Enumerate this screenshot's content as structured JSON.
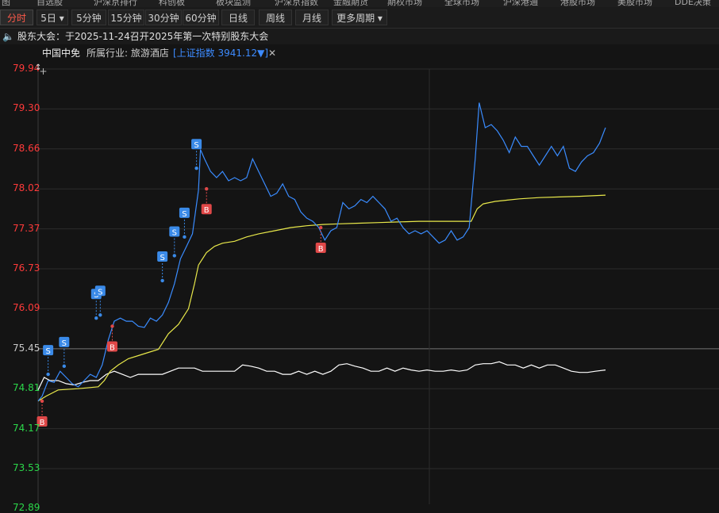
{
  "top_tabs": [
    "自选股",
    "沪深京排行",
    "科创板",
    "板块监测",
    "沪深京指数",
    "金融期货",
    "期权市场",
    "全球市场",
    "沪深港通",
    "港股市场",
    "美股市场",
    "DDE决策"
  ],
  "top_left": "图",
  "periods": [
    {
      "label": "分时",
      "active": true
    },
    {
      "label": "5日 ▾",
      "active": false
    },
    {
      "label": "5分钟",
      "active": false
    },
    {
      "label": "15分钟",
      "active": false
    },
    {
      "label": "30分钟",
      "active": false
    },
    {
      "label": "60分钟",
      "active": false
    },
    {
      "label": "日线",
      "active": false
    },
    {
      "label": "周线",
      "active": false
    },
    {
      "label": "月线",
      "active": false
    },
    {
      "label": "更多周期 ▾",
      "active": false
    }
  ],
  "notice": {
    "text": "股东大会：于2025-11-24召开2025年第一次特别股东大会"
  },
  "info": {
    "stock_name": "中国中免",
    "industry": "所属行业: 旅游酒店",
    "index": "[上证指数 3941.12▼]",
    "close": "✕"
  },
  "colors": {
    "up": "#ff3a3a",
    "down": "#2bd84a",
    "ref": "#c8c8c8",
    "price_line": "#ffffff",
    "avg_line": "#e8e84a",
    "index_line": "#3a8cff",
    "buy": "#e04848",
    "sell": "#3a8ae8"
  },
  "chart_data": {
    "type": "line",
    "ylim": [
      73.53,
      79.94
    ],
    "prev_close": 75.45,
    "y_ticks": [
      "79.94",
      "79.30",
      "78.66",
      "78.02",
      "77.37",
      "76.73",
      "76.09",
      "75.45",
      "74.81",
      "74.17",
      "73.53",
      "72.89"
    ],
    "series": [
      {
        "values": [
          [
            0,
            74.62
          ],
          [
            2,
            74.7
          ],
          [
            5,
            74.95
          ],
          [
            8,
            74.92
          ],
          [
            11,
            75.1
          ],
          [
            14,
            75.0
          ],
          [
            17,
            74.9
          ],
          [
            20,
            74.85
          ],
          [
            23,
            74.95
          ],
          [
            26,
            75.05
          ],
          [
            29,
            75.0
          ],
          [
            32,
            75.2
          ],
          [
            35,
            75.6
          ],
          [
            38,
            75.9
          ],
          [
            41,
            75.95
          ],
          [
            44,
            75.9
          ],
          [
            47,
            75.9
          ],
          [
            50,
            75.82
          ],
          [
            53,
            75.8
          ],
          [
            56,
            75.95
          ],
          [
            59,
            75.9
          ],
          [
            62,
            76.0
          ],
          [
            65,
            76.2
          ],
          [
            68,
            76.5
          ],
          [
            71,
            76.9
          ],
          [
            74,
            77.1
          ],
          [
            77,
            77.3
          ],
          [
            80,
            78.0
          ],
          [
            81,
            78.65
          ],
          [
            83,
            78.5
          ],
          [
            86,
            78.3
          ],
          [
            89,
            78.2
          ],
          [
            92,
            78.3
          ],
          [
            95,
            78.15
          ],
          [
            98,
            78.2
          ],
          [
            101,
            78.15
          ],
          [
            104,
            78.2
          ],
          [
            107,
            78.5
          ],
          [
            110,
            78.3
          ],
          [
            113,
            78.1
          ],
          [
            116,
            77.9
          ],
          [
            119,
            77.95
          ],
          [
            122,
            78.1
          ],
          [
            125,
            77.9
          ],
          [
            128,
            77.85
          ],
          [
            131,
            77.65
          ],
          [
            134,
            77.55
          ],
          [
            137,
            77.5
          ],
          [
            140,
            77.4
          ],
          [
            143,
            77.2
          ],
          [
            146,
            77.35
          ],
          [
            149,
            77.4
          ],
          [
            152,
            77.8
          ],
          [
            155,
            77.7
          ],
          [
            158,
            77.75
          ],
          [
            161,
            77.85
          ],
          [
            164,
            77.8
          ],
          [
            167,
            77.9
          ],
          [
            170,
            77.8
          ],
          [
            173,
            77.7
          ],
          [
            176,
            77.5
          ],
          [
            179,
            77.55
          ],
          [
            182,
            77.4
          ],
          [
            185,
            77.3
          ],
          [
            188,
            77.35
          ],
          [
            191,
            77.3
          ],
          [
            194,
            77.35
          ],
          [
            197,
            77.25
          ],
          [
            200,
            77.15
          ],
          [
            203,
            77.2
          ],
          [
            206,
            77.35
          ],
          [
            209,
            77.2
          ],
          [
            212,
            77.25
          ],
          [
            215,
            77.4
          ],
          [
            218,
            78.5
          ],
          [
            220,
            79.4
          ],
          [
            223,
            79.0
          ],
          [
            226,
            79.05
          ],
          [
            229,
            78.95
          ],
          [
            232,
            78.8
          ],
          [
            235,
            78.6
          ],
          [
            238,
            78.85
          ],
          [
            241,
            78.7
          ],
          [
            244,
            78.7
          ],
          [
            247,
            78.55
          ],
          [
            250,
            78.4
          ],
          [
            253,
            78.55
          ],
          [
            256,
            78.7
          ],
          [
            259,
            78.55
          ],
          [
            262,
            78.7
          ],
          [
            265,
            78.35
          ],
          [
            268,
            78.3
          ],
          [
            271,
            78.45
          ],
          [
            274,
            78.55
          ],
          [
            277,
            78.6
          ],
          [
            280,
            78.75
          ],
          [
            283,
            79.0
          ]
        ]
      },
      {
        "values": [
          [
            0,
            74.62
          ],
          [
            4,
            74.7
          ],
          [
            10,
            74.8
          ],
          [
            20,
            74.82
          ],
          [
            30,
            74.85
          ],
          [
            33,
            74.95
          ],
          [
            36,
            75.1
          ],
          [
            40,
            75.2
          ],
          [
            45,
            75.3
          ],
          [
            50,
            75.35
          ],
          [
            55,
            75.4
          ],
          [
            60,
            75.45
          ],
          [
            65,
            75.7
          ],
          [
            70,
            75.85
          ],
          [
            75,
            76.1
          ],
          [
            78,
            76.5
          ],
          [
            80,
            76.8
          ],
          [
            84,
            77.0
          ],
          [
            88,
            77.1
          ],
          [
            92,
            77.15
          ],
          [
            98,
            77.18
          ],
          [
            104,
            77.25
          ],
          [
            110,
            77.3
          ],
          [
            118,
            77.35
          ],
          [
            126,
            77.4
          ],
          [
            134,
            77.43
          ],
          [
            142,
            77.45
          ],
          [
            150,
            77.46
          ],
          [
            160,
            77.47
          ],
          [
            170,
            77.48
          ],
          [
            180,
            77.49
          ],
          [
            190,
            77.5
          ],
          [
            200,
            77.5
          ],
          [
            210,
            77.5
          ],
          [
            216,
            77.5
          ],
          [
            219,
            77.7
          ],
          [
            222,
            77.78
          ],
          [
            228,
            77.82
          ],
          [
            234,
            77.84
          ],
          [
            240,
            77.86
          ],
          [
            250,
            77.88
          ],
          [
            260,
            77.89
          ],
          [
            270,
            77.9
          ],
          [
            283,
            77.92
          ]
        ]
      },
      {
        "values": [
          [
            0,
            74.8
          ],
          [
            3,
            75.0
          ],
          [
            6,
            74.95
          ],
          [
            10,
            74.95
          ],
          [
            14,
            74.9
          ],
          [
            18,
            74.88
          ],
          [
            22,
            74.92
          ],
          [
            26,
            74.95
          ],
          [
            30,
            74.95
          ],
          [
            34,
            75.05
          ],
          [
            38,
            75.1
          ],
          [
            42,
            75.05
          ],
          [
            46,
            75.0
          ],
          [
            50,
            75.05
          ],
          [
            54,
            75.05
          ],
          [
            58,
            75.05
          ],
          [
            62,
            75.05
          ],
          [
            66,
            75.1
          ],
          [
            70,
            75.15
          ],
          [
            74,
            75.15
          ],
          [
            78,
            75.15
          ],
          [
            82,
            75.1
          ],
          [
            86,
            75.1
          ],
          [
            90,
            75.1
          ],
          [
            94,
            75.1
          ],
          [
            98,
            75.1
          ],
          [
            102,
            75.2
          ],
          [
            106,
            75.18
          ],
          [
            110,
            75.15
          ],
          [
            114,
            75.1
          ],
          [
            118,
            75.1
          ],
          [
            122,
            75.05
          ],
          [
            126,
            75.05
          ],
          [
            130,
            75.1
          ],
          [
            134,
            75.05
          ],
          [
            138,
            75.1
          ],
          [
            142,
            75.05
          ],
          [
            146,
            75.1
          ],
          [
            150,
            75.2
          ],
          [
            154,
            75.22
          ],
          [
            158,
            75.18
          ],
          [
            162,
            75.15
          ],
          [
            166,
            75.1
          ],
          [
            170,
            75.1
          ],
          [
            174,
            75.15
          ],
          [
            178,
            75.1
          ],
          [
            182,
            75.15
          ],
          [
            186,
            75.12
          ],
          [
            190,
            75.1
          ],
          [
            194,
            75.12
          ],
          [
            198,
            75.1
          ],
          [
            202,
            75.1
          ],
          [
            206,
            75.12
          ],
          [
            210,
            75.1
          ],
          [
            214,
            75.12
          ],
          [
            218,
            75.2
          ],
          [
            222,
            75.22
          ],
          [
            226,
            75.22
          ],
          [
            230,
            75.25
          ],
          [
            234,
            75.2
          ],
          [
            238,
            75.2
          ],
          [
            242,
            75.15
          ],
          [
            246,
            75.2
          ],
          [
            250,
            75.15
          ],
          [
            254,
            75.2
          ],
          [
            258,
            75.2
          ],
          [
            262,
            75.15
          ],
          [
            266,
            75.1
          ],
          [
            270,
            75.08
          ],
          [
            274,
            75.08
          ],
          [
            278,
            75.1
          ],
          [
            283,
            75.12
          ]
        ]
      }
    ],
    "markers": [
      {
        "type": "B",
        "x": 2,
        "y": 74.62,
        "below": true
      },
      {
        "type": "S",
        "x": 5,
        "y": 75.05
      },
      {
        "type": "S",
        "x": 13,
        "y": 75.18
      },
      {
        "type": "S",
        "x": 29,
        "y": 75.95
      },
      {
        "type": "S",
        "x": 31,
        "y": 76.0
      },
      {
        "type": "B",
        "x": 37,
        "y": 75.82,
        "below": true
      },
      {
        "type": "S",
        "x": 62,
        "y": 76.55
      },
      {
        "type": "S",
        "x": 68,
        "y": 76.95
      },
      {
        "type": "S",
        "x": 73,
        "y": 77.25
      },
      {
        "type": "S",
        "x": 79,
        "y": 78.35
      },
      {
        "type": "B",
        "x": 84,
        "y": 78.02,
        "below": true
      },
      {
        "type": "B",
        "x": 141,
        "y": 77.4,
        "below": true
      }
    ]
  }
}
